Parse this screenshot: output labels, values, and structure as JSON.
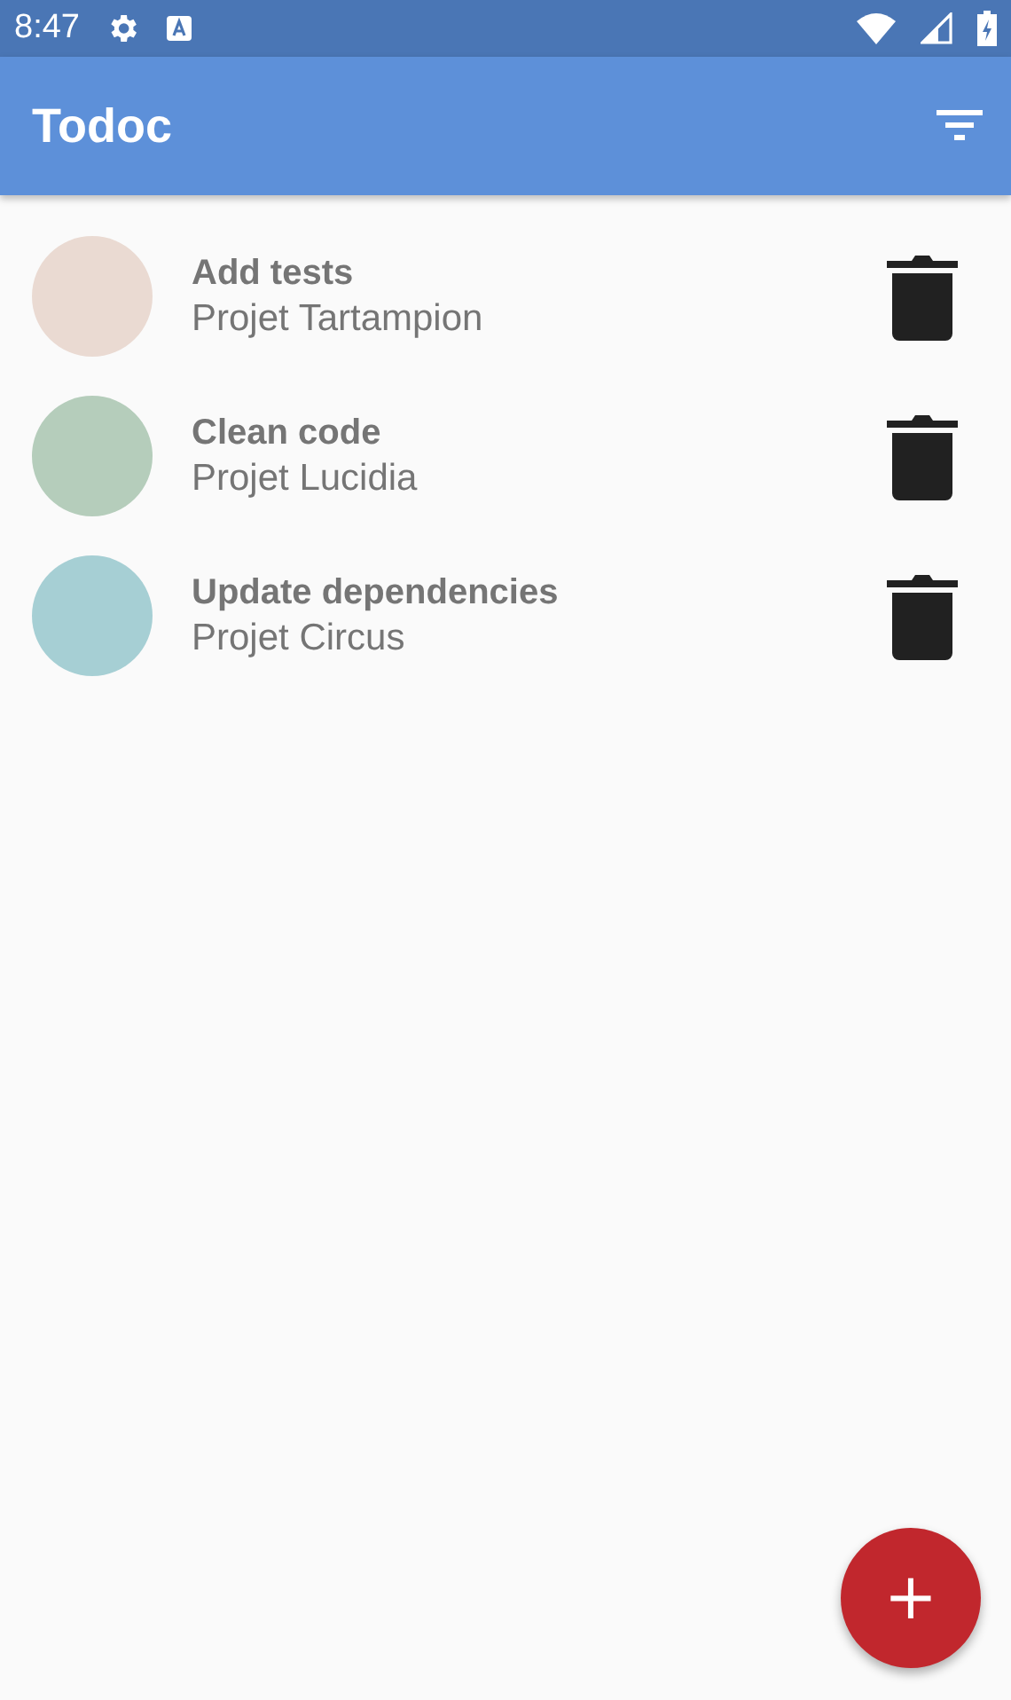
{
  "status_bar": {
    "time": "8:47"
  },
  "app_bar": {
    "title": "Todoc"
  },
  "tasks": [
    {
      "name": "Add tests",
      "project": "Projet Tartampion",
      "color": "#eadad2"
    },
    {
      "name": "Clean code",
      "project": "Projet Lucidia",
      "color": "#b5cdbb"
    },
    {
      "name": "Update dependencies",
      "project": "Projet Circus",
      "color": "#a6cfd4"
    }
  ],
  "fab": {
    "label": "+"
  }
}
